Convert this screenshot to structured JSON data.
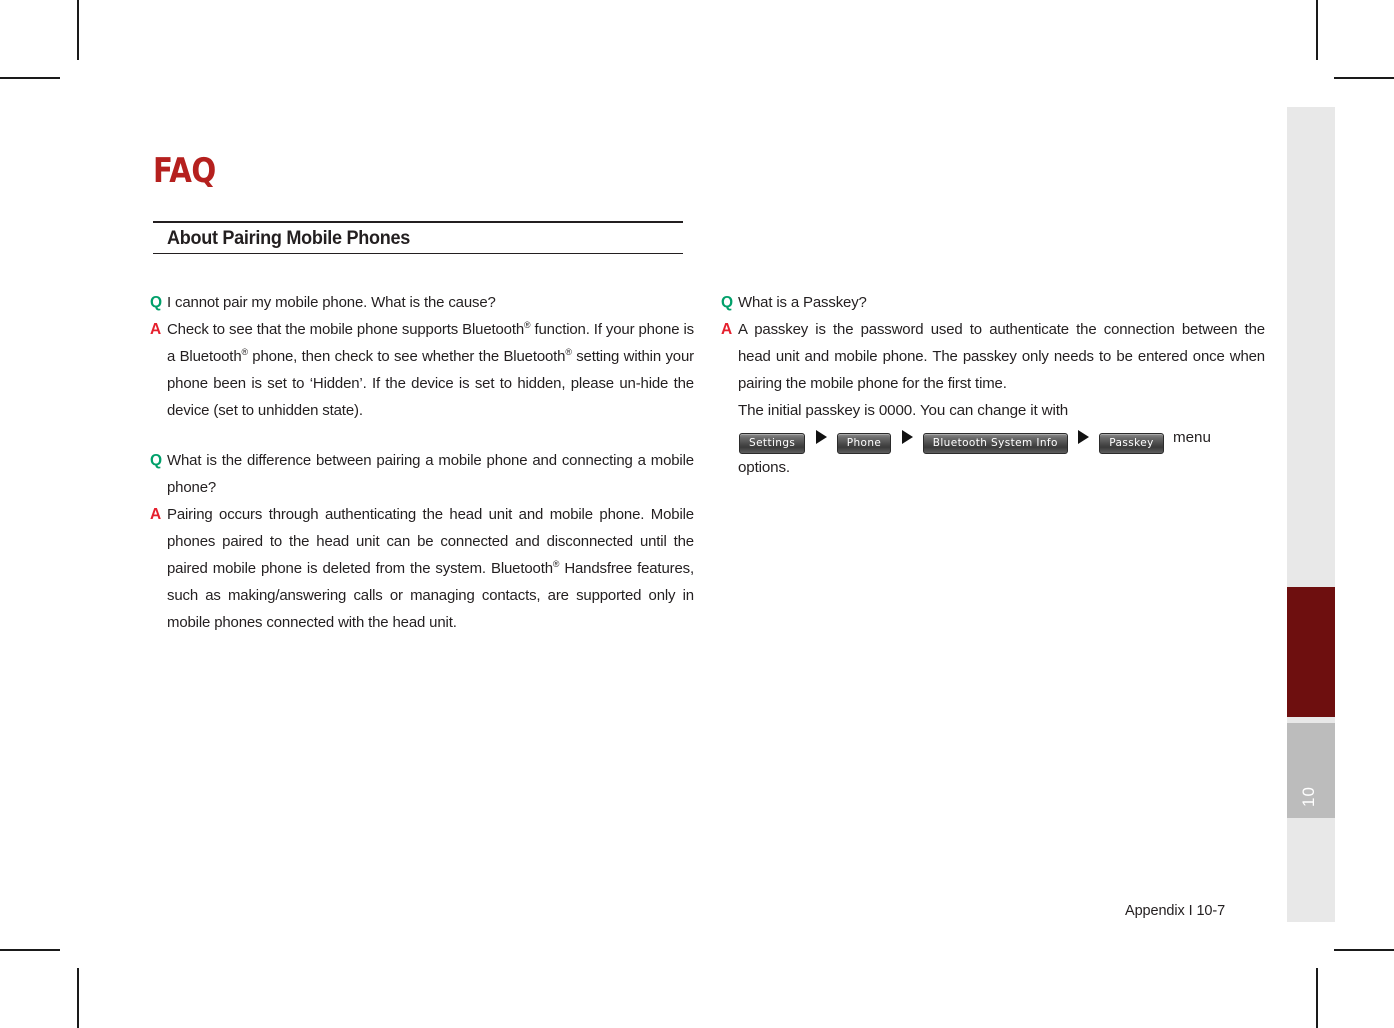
{
  "page": {
    "heading": "FAQ",
    "section_title": "About Pairing Mobile Phones",
    "footer": "Appendix I 10-7",
    "tab_number": "10",
    "colors": {
      "heading_red": "#b5201e",
      "q_marker": "#00a06a",
      "a_marker": "#e5202e",
      "tab_red": "#6e0f0f",
      "tab_gray": "#bcbcbc",
      "tab_light": "#e8e8e8"
    }
  },
  "left_column": {
    "qa": [
      {
        "q_label": "Q",
        "q_text": "I cannot pair my mobile phone. What is the cause?",
        "a_label": "A",
        "a_text_part1": "Check to see that the mobile phone supports Bluetooth",
        "a_text_part2": " function. If your phone is a Bluetooth",
        "a_text_part3": " phone, then check to see whether the Bluetooth",
        "a_text_part4": " setting within your phone been is set to ‘Hidden’. If the device is set to hidden, please un-hide the device (set to unhidden state).",
        "registered_mark": "®"
      },
      {
        "q_label": "Q",
        "q_text": "What is the difference between pairing a mobile phone and connecting a mobile phone?",
        "a_label": "A",
        "a_text_part1": "Pairing occurs through authenticating the head unit and mobile phone. Mobile phones paired to the head unit can be connected and disconnected until the paired mobile phone is deleted from the system. Bluetooth",
        "a_text_part2": " Handsfree features, such as making/answering calls or managing contacts, are supported only in mobile phones connected with the head unit.",
        "registered_mark": "®"
      }
    ]
  },
  "right_column": {
    "qa": [
      {
        "q_label": "Q",
        "q_text": "What is a Passkey?",
        "a_label": "A",
        "a_text": "A passkey is the password used to authenticate the connection between the head unit and mobile phone. The passkey only needs to be entered once when pairing the mobile phone for the first time.",
        "extra_line": "The initial passkey is 0000. You can change it with",
        "menu_path": {
          "buttons": [
            "Settings",
            "Phone",
            "Bluetooth System Info",
            "Passkey"
          ],
          "separator_icon": "triangle-right-icon",
          "trailing_text": "menu",
          "closing_text": "options."
        }
      }
    ]
  }
}
